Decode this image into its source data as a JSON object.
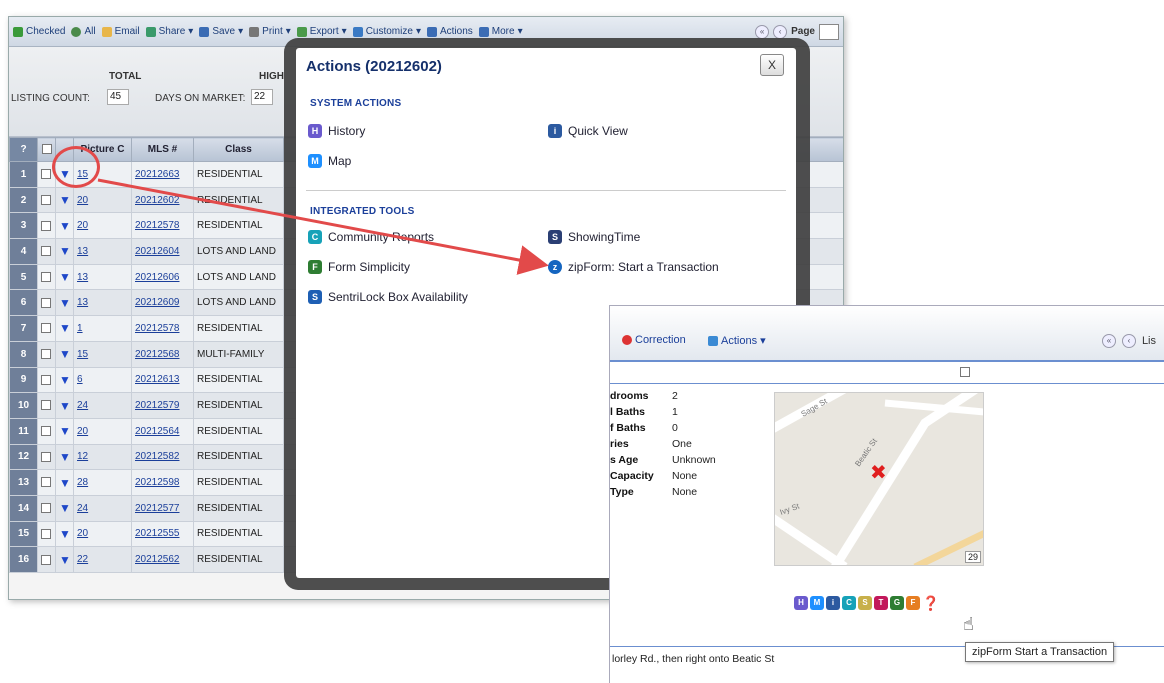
{
  "toolbar": {
    "checked": "Checked",
    "all": "All",
    "email": "Email",
    "share": "Share",
    "save": "Save",
    "print": "Print",
    "export": "Export",
    "customize": "Customize",
    "actions": "Actions",
    "more": "More",
    "page_label": "Page"
  },
  "summary": {
    "total_heading": "TOTAL",
    "high_heading": "HIGH",
    "listing_count_label": "LISTING COUNT:",
    "listing_count_value": "45",
    "days_on_market_label": "DAYS ON MARKET:",
    "days_on_market_value": "22"
  },
  "table": {
    "headers": [
      "?",
      "",
      "",
      "Picture C",
      "MLS #",
      "Class"
    ],
    "rows": [
      {
        "num": "1",
        "pics": "15",
        "mls": "20212663",
        "class": "RESIDENTIAL"
      },
      {
        "num": "2",
        "pics": "20",
        "mls": "20212602",
        "class": "RESIDENTIAL"
      },
      {
        "num": "3",
        "pics": "20",
        "mls": "20212578",
        "class": "RESIDENTIAL"
      },
      {
        "num": "4",
        "pics": "13",
        "mls": "20212604",
        "class": "LOTS AND LAND"
      },
      {
        "num": "5",
        "pics": "13",
        "mls": "20212606",
        "class": "LOTS AND LAND"
      },
      {
        "num": "6",
        "pics": "13",
        "mls": "20212609",
        "class": "LOTS AND LAND"
      },
      {
        "num": "7",
        "pics": "1",
        "mls": "20212578",
        "class": "RESIDENTIAL"
      },
      {
        "num": "8",
        "pics": "15",
        "mls": "20212568",
        "class": "MULTI-FAMILY"
      },
      {
        "num": "9",
        "pics": "6",
        "mls": "20212613",
        "class": "RESIDENTIAL"
      },
      {
        "num": "10",
        "pics": "24",
        "mls": "20212579",
        "class": "RESIDENTIAL"
      },
      {
        "num": "11",
        "pics": "20",
        "mls": "20212564",
        "class": "RESIDENTIAL"
      },
      {
        "num": "12",
        "pics": "12",
        "mls": "20212582",
        "class": "RESIDENTIAL"
      },
      {
        "num": "13",
        "pics": "28",
        "mls": "20212598",
        "class": "RESIDENTIAL"
      },
      {
        "num": "14",
        "pics": "24",
        "mls": "20212577",
        "class": "RESIDENTIAL"
      },
      {
        "num": "15",
        "pics": "20",
        "mls": "20212555",
        "class": "RESIDENTIAL"
      },
      {
        "num": "16",
        "pics": "22",
        "mls": "20212562",
        "class": "RESIDENTIAL"
      }
    ]
  },
  "modal": {
    "title": "Actions (20212602)",
    "close": "X",
    "system_actions_title": "SYSTEM ACTIONS",
    "system_actions": [
      {
        "label": "History",
        "icon": "H",
        "color": "#6a5acd"
      },
      {
        "label": "Quick View",
        "icon": "i",
        "color": "#2c5aa0"
      },
      {
        "label": "Map",
        "icon": "M",
        "color": "#1e90ff"
      }
    ],
    "integrated_tools_title": "INTEGRATED TOOLS",
    "integrated_tools": [
      {
        "label": "Community Reports",
        "icon": "C",
        "color": "#17a2b8"
      },
      {
        "label": "ShowingTime",
        "icon": "S",
        "color": "#2b3f74"
      },
      {
        "label": "Form Simplicity",
        "icon": "F",
        "color": "#2e7d32"
      },
      {
        "label": "zipForm: Start a Transaction",
        "icon": "z",
        "color": "#1565c0"
      },
      {
        "label": "SentriLock Box Availability",
        "icon": "S",
        "color": "#1e5fb4"
      }
    ]
  },
  "detail": {
    "correction": "Correction",
    "actions": "Actions",
    "pager_label": "Lis",
    "props": [
      {
        "label": "drooms",
        "value": "2"
      },
      {
        "label": "l Baths",
        "value": "1"
      },
      {
        "label": "f Baths",
        "value": "0"
      },
      {
        "label": "ries",
        "value": "One"
      },
      {
        "label": "s Age",
        "value": "Unknown"
      },
      {
        "label": "Capacity",
        "value": "None"
      },
      {
        "label": "Type",
        "value": "None"
      }
    ],
    "map_streets": [
      "Sage St",
      "Beatic St",
      "Ivy St"
    ],
    "map_zoom": "29",
    "icons": [
      {
        "letter": "H",
        "color": "#6a5acd"
      },
      {
        "letter": "M",
        "color": "#1e90ff"
      },
      {
        "letter": "i",
        "color": "#2c5aa0"
      },
      {
        "letter": "C",
        "color": "#17a2b8"
      },
      {
        "letter": "S",
        "color": "#c8b04a"
      },
      {
        "letter": "T",
        "color": "#c2185b"
      },
      {
        "letter": "G",
        "color": "#2e7d32"
      },
      {
        "letter": "F",
        "color": "#e67e22"
      }
    ],
    "directions": "lorley Rd., then right onto Beatic St",
    "tooltip": "zipForm Start a Transaction"
  },
  "colors": {
    "accent": "#1b3f9a",
    "highlight": "#e24a4a"
  }
}
